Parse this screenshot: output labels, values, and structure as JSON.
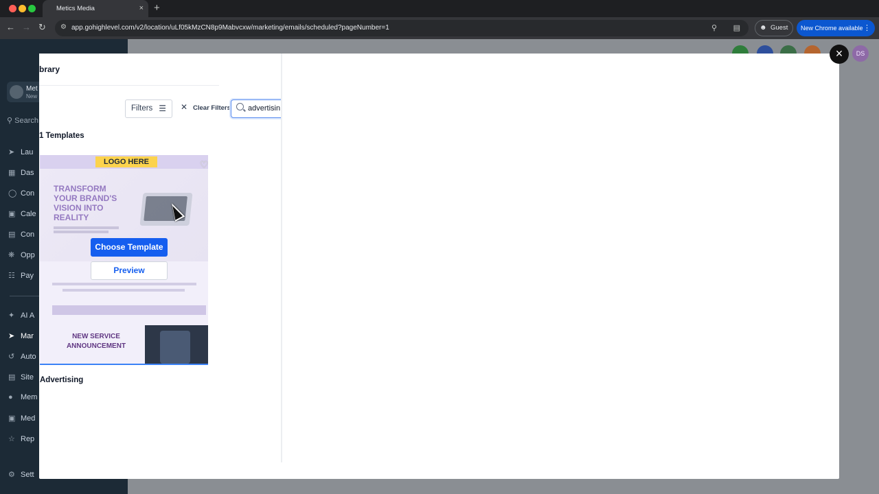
{
  "browser": {
    "tab_title": "Metics Media",
    "tab_close": "×",
    "new_tab": "+",
    "url": "app.gohighlevel.com/v2/location/uLf05kMzCN8p9Mabvcxw/marketing/emails/scheduled?pageNumber=1",
    "profile_label": "Guest",
    "update_label": "New Chrome available"
  },
  "sidebar": {
    "account_name": "Met",
    "account_sub": "New",
    "search_placeholder": "Search",
    "items": [
      {
        "label": "Lau",
        "icon": "rocket-icon"
      },
      {
        "label": "Das",
        "icon": "dashboard-icon"
      },
      {
        "label": "Con",
        "icon": "chat-icon"
      },
      {
        "label": "Cale",
        "icon": "calendar-icon"
      },
      {
        "label": "Con",
        "icon": "contacts-icon"
      },
      {
        "label": "Opp",
        "icon": "opportunities-icon"
      },
      {
        "label": "Pay",
        "icon": "payments-icon"
      },
      {
        "label": "AI A",
        "icon": "sparkle-icon"
      },
      {
        "label": "Mar",
        "icon": "send-icon"
      },
      {
        "label": "Auto",
        "icon": "automation-icon"
      },
      {
        "label": "Site",
        "icon": "sites-icon"
      },
      {
        "label": "Mem",
        "icon": "membership-icon"
      },
      {
        "label": "Med",
        "icon": "media-icon"
      },
      {
        "label": "Rep",
        "icon": "star-icon"
      },
      {
        "label": "Sett",
        "icon": "settings-icon"
      }
    ]
  },
  "header": {
    "user_initials": "DS"
  },
  "modal": {
    "title": "brary",
    "filters_label": "Filters",
    "clear_filters_label": "Clear Filters",
    "search_value": "advertisin",
    "results_count": "1 Templates",
    "close_label": "×",
    "template": {
      "logo_text": "LOGO HERE",
      "headline": "TRANSFORM YOUR BRAND'S VISION INTO REALITY",
      "section_title": "NEW SERVICE ANNOUNCEMENT",
      "choose_label": "Choose Template",
      "preview_label": "Preview",
      "name": "Advertising"
    }
  },
  "colors": {
    "primary": "#155eef",
    "chrome_update": "#0b57d0"
  }
}
